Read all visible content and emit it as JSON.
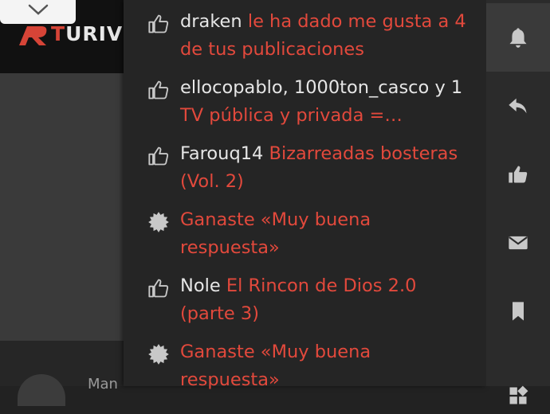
{
  "background": {
    "logo_letter": "T",
    "logo_rest": "URIV",
    "footer_snippet": "Man"
  },
  "notifications": [
    {
      "icon": "thumbs-up-icon",
      "user": "draken",
      "text": "le ha dado me gusta a 4 de tus publicaciones"
    },
    {
      "icon": "thumbs-up-icon",
      "user": "ellocopablo, 1000ton_casco y 1",
      "text": "TV pública y privada =…"
    },
    {
      "icon": "thumbs-up-icon",
      "user": "Farouq14",
      "text": "Bizarreadas bosteras (Vol. 2)"
    },
    {
      "icon": "badge-icon",
      "user": "",
      "text": "Ganaste «Muy buena respuesta»"
    },
    {
      "icon": "thumbs-up-icon",
      "user": "Nole",
      "text": "El Rincon de Dios 2.0 (parte 3)"
    },
    {
      "icon": "badge-icon",
      "user": "",
      "text": "Ganaste «Muy buena respuesta»"
    }
  ],
  "sidebar": {
    "items": [
      {
        "icon": "bell-icon",
        "active": true
      },
      {
        "icon": "reply-icon",
        "active": false
      },
      {
        "icon": "like-icon",
        "active": false
      },
      {
        "icon": "envelope-icon",
        "active": false
      },
      {
        "icon": "bookmark-icon",
        "active": false
      },
      {
        "icon": "grid-icon",
        "active": false
      }
    ]
  },
  "colors": {
    "link": "#e2493c",
    "text": "#e6e6e6",
    "icon": "#c8c8c8",
    "panel_bg": "#252525",
    "sidebar_bg": "#2b2b2b"
  }
}
